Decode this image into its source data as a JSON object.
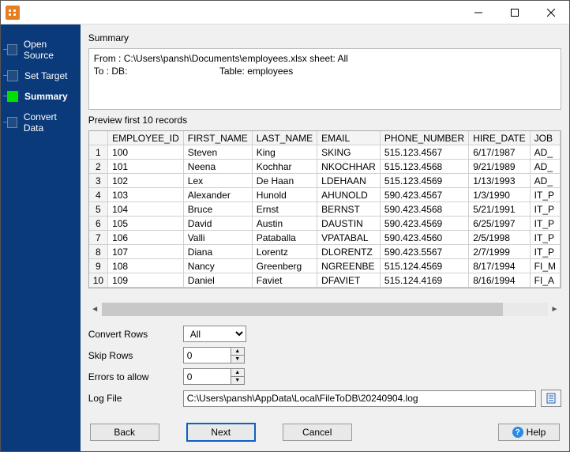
{
  "sidebar": {
    "steps": [
      {
        "label": "Open Source"
      },
      {
        "label": "Set Target"
      },
      {
        "label": "Summary"
      },
      {
        "label": "Convert Data"
      }
    ],
    "active_index": 2
  },
  "summary": {
    "heading": "Summary",
    "line1": "From : C:\\Users\\pansh\\Documents\\employees.xlsx sheet: All",
    "line2": "To : DB:                                   Table: employees"
  },
  "preview": {
    "heading": "Preview first 10 records",
    "columns": [
      "EMPLOYEE_ID",
      "FIRST_NAME",
      "LAST_NAME",
      "EMAIL",
      "PHONE_NUMBER",
      "HIRE_DATE",
      "JOB"
    ],
    "rows": [
      [
        "100",
        "Steven",
        "King",
        "SKING",
        "515.123.4567",
        "6/17/1987",
        "AD_"
      ],
      [
        "101",
        "Neena",
        "Kochhar",
        "NKOCHHAR",
        "515.123.4568",
        "9/21/1989",
        "AD_"
      ],
      [
        "102",
        "Lex",
        "De Haan",
        "LDEHAAN",
        "515.123.4569",
        "1/13/1993",
        "AD_"
      ],
      [
        "103",
        "Alexander",
        "Hunold",
        "AHUNOLD",
        "590.423.4567",
        "1/3/1990",
        "IT_P"
      ],
      [
        "104",
        "Bruce",
        "Ernst",
        "BERNST",
        "590.423.4568",
        "5/21/1991",
        "IT_P"
      ],
      [
        "105",
        "David",
        "Austin",
        "DAUSTIN",
        "590.423.4569",
        "6/25/1997",
        "IT_P"
      ],
      [
        "106",
        "Valli",
        "Pataballa",
        "VPATABAL",
        "590.423.4560",
        "2/5/1998",
        "IT_P"
      ],
      [
        "107",
        "Diana",
        "Lorentz",
        "DLORENTZ",
        "590.423.5567",
        "2/7/1999",
        "IT_P"
      ],
      [
        "108",
        "Nancy",
        "Greenberg",
        "NGREENBE",
        "515.124.4569",
        "8/17/1994",
        "FI_M"
      ],
      [
        "109",
        "Daniel",
        "Faviet",
        "DFAVIET",
        "515.124.4169",
        "8/16/1994",
        "FI_A"
      ]
    ]
  },
  "form": {
    "convert_rows_label": "Convert Rows",
    "convert_rows_value": "All",
    "skip_rows_label": "Skip Rows",
    "skip_rows_value": "0",
    "errors_label": "Errors to allow",
    "errors_value": "0",
    "logfile_label": "Log File",
    "logfile_value": "C:\\Users\\pansh\\AppData\\Local\\FileToDB\\20240904.log"
  },
  "buttons": {
    "back": "Back",
    "next": "Next",
    "cancel": "Cancel",
    "help": "Help"
  }
}
